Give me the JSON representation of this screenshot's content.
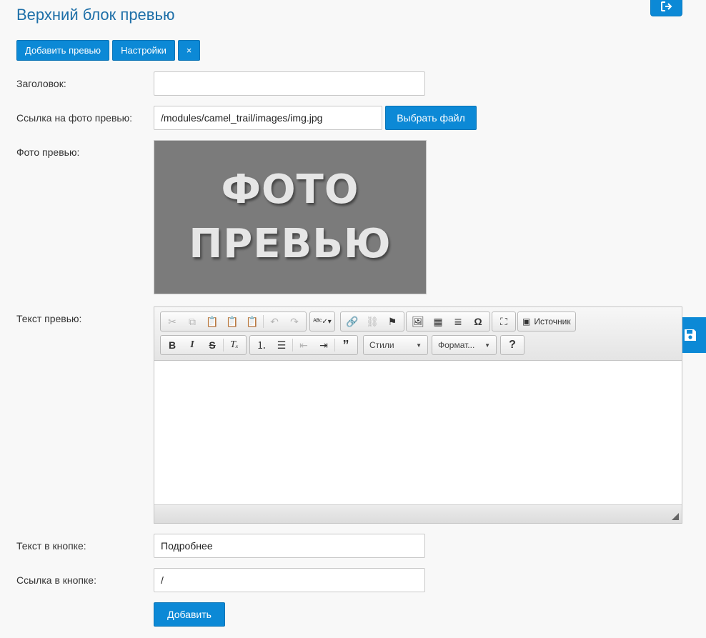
{
  "header": {
    "title": "Верхний блок превью",
    "exit_icon": "exit-icon"
  },
  "actions": {
    "add_preview_label": "Добавить превью",
    "settings_label": "Настройки",
    "close_label": "×"
  },
  "form": {
    "title_label": "Заголовок:",
    "title_value": "",
    "photo_link_label": "Ссылка на фото превью:",
    "photo_link_value": "/modules/camel_trail/images/img.jpg",
    "choose_file_label": "Выбрать файл",
    "photo_label": "Фото превью:",
    "photo_placeholder_line1": "ФОТО",
    "photo_placeholder_line2": "ПРЕВЬЮ",
    "text_label": "Текст превью:",
    "button_text_label": "Текст в кнопке:",
    "button_text_value": "Подробнее",
    "button_link_label": "Ссылка в кнопке:",
    "button_link_value": "/",
    "submit_label": "Добавить"
  },
  "editor": {
    "source_label": "Источник",
    "styles_label": "Стили",
    "format_label": "Формат..."
  },
  "colors": {
    "accent": "#0c89d6",
    "title": "#1e6fa8"
  }
}
